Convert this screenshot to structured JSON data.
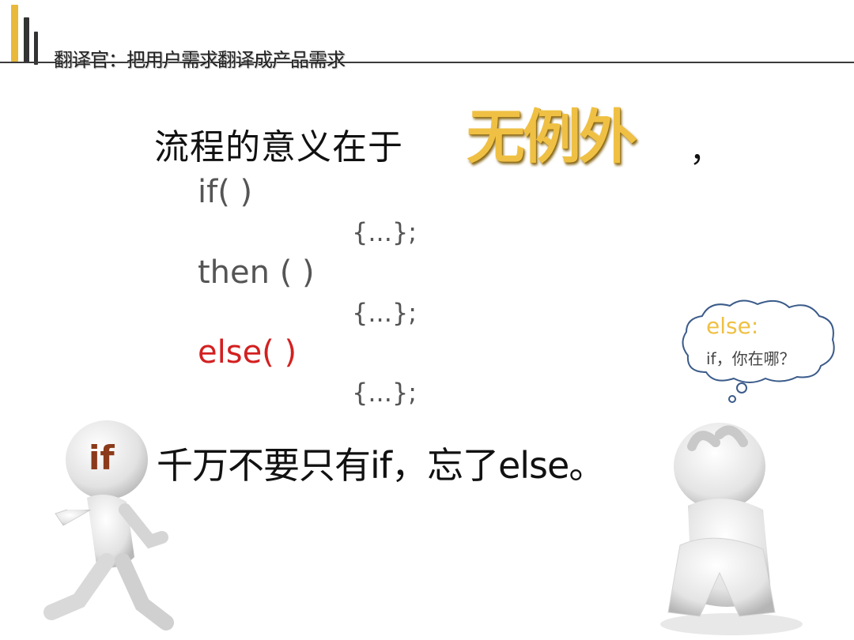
{
  "header": {
    "title": "翻译官：把用户需求翻译成产品需求"
  },
  "slide": {
    "heading": "流程的意义在于",
    "highlight": "无例外",
    "heading_end": "，",
    "code": {
      "if_line": "if( )",
      "block1": "{...};",
      "then_line": "then (  )",
      "block2": "{...};",
      "else_line": "else( )",
      "block3": "{...};"
    },
    "bottom_text": "千万不要只有if，忘了else。"
  },
  "left_figure": {
    "label": "if"
  },
  "thought_bubble": {
    "line1": "else:",
    "line2": "if，你在哪？"
  },
  "colors": {
    "accent_gold": "#efc043",
    "else_red": "#d32020",
    "if_brown": "#8b3a1a"
  }
}
